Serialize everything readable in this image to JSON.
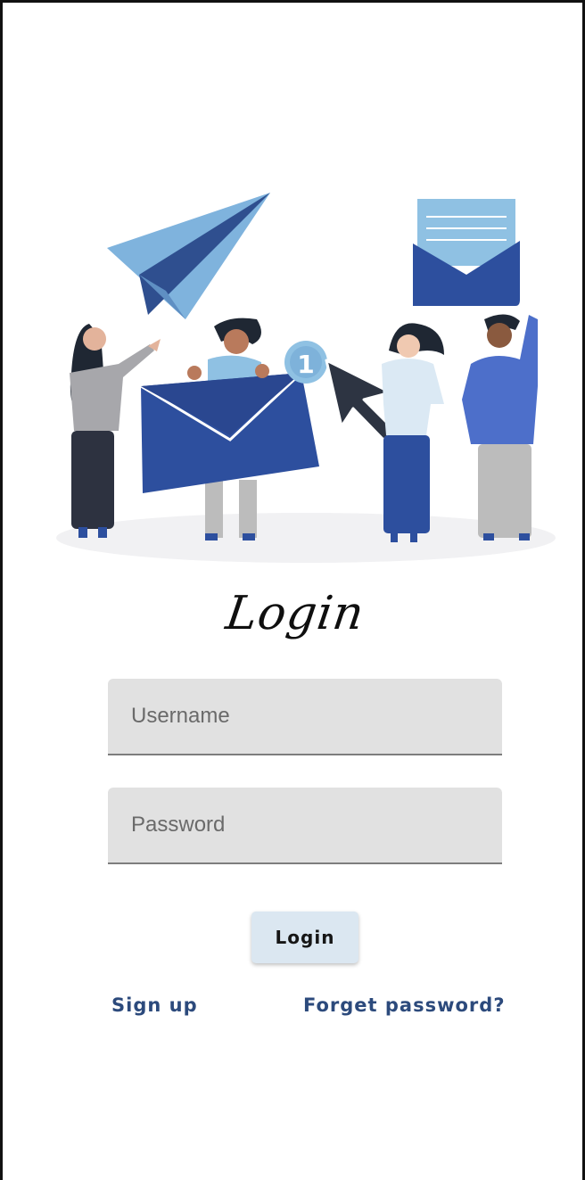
{
  "screen": {
    "title": "Login"
  },
  "form": {
    "username_placeholder": "Username",
    "password_placeholder": "Password",
    "login_label": "Login"
  },
  "links": {
    "signup_label": "Sign up",
    "forget_label": "Forget password?"
  },
  "illustration": {
    "badge_count": "1",
    "icons": [
      "paper-plane-icon",
      "envelope-icon",
      "cursor-icon",
      "notification-badge-icon"
    ]
  },
  "colors": {
    "envelope_dark": "#2d4f9e",
    "envelope_light": "#8fc1e3",
    "button_bg": "#dbe7f1",
    "link": "#2c4a7c",
    "field_bg": "#e1e1e1"
  }
}
